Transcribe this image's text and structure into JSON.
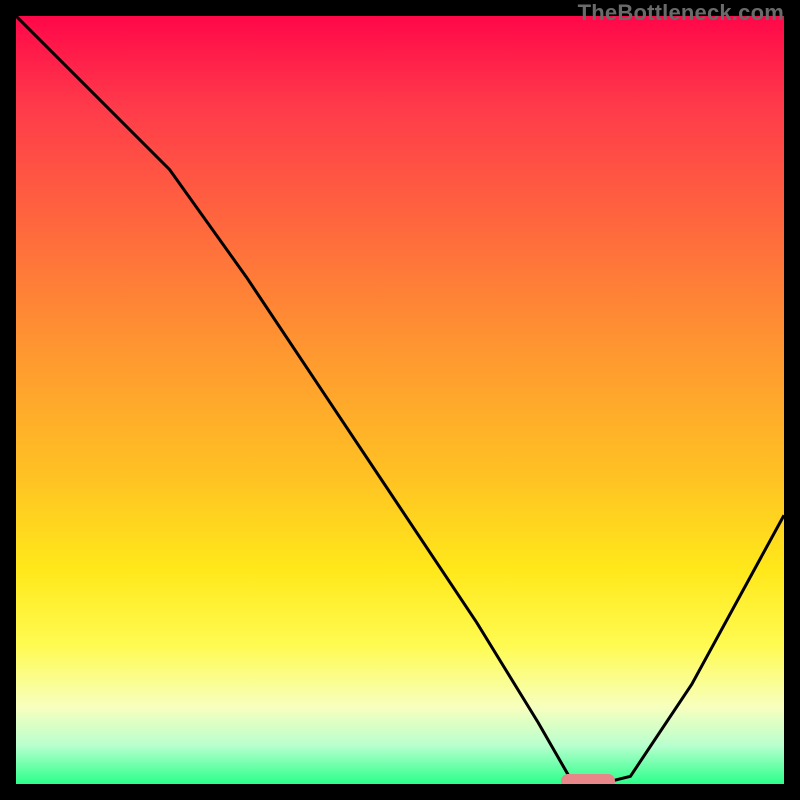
{
  "watermark": "TheBottleneck.com",
  "colors": {
    "curve": "#000000",
    "marker": "#e8878a",
    "frame": "#000000"
  },
  "chart_data": {
    "type": "line",
    "title": "",
    "xlabel": "",
    "ylabel": "",
    "xlim": [
      0,
      100
    ],
    "ylim": [
      0,
      100
    ],
    "series": [
      {
        "name": "bottleneck-curve",
        "x": [
          0,
          12,
          20,
          30,
          40,
          50,
          60,
          68,
          72,
          76,
          80,
          88,
          100
        ],
        "values": [
          100,
          88,
          80,
          66,
          51,
          36,
          21,
          8,
          1,
          0,
          1,
          13,
          35
        ]
      }
    ],
    "marker": {
      "x_start": 71,
      "x_end": 78,
      "y": 0
    },
    "background_gradient": {
      "stops": [
        {
          "pos": 0,
          "color": "#ff0749"
        },
        {
          "pos": 12,
          "color": "#ff3b4a"
        },
        {
          "pos": 28,
          "color": "#ff6a3d"
        },
        {
          "pos": 44,
          "color": "#ff9830"
        },
        {
          "pos": 60,
          "color": "#ffc223"
        },
        {
          "pos": 72,
          "color": "#ffe81a"
        },
        {
          "pos": 82,
          "color": "#fffb52"
        },
        {
          "pos": 90,
          "color": "#f7ffbe"
        },
        {
          "pos": 95,
          "color": "#b8ffce"
        },
        {
          "pos": 100,
          "color": "#2aff8a"
        }
      ]
    }
  }
}
